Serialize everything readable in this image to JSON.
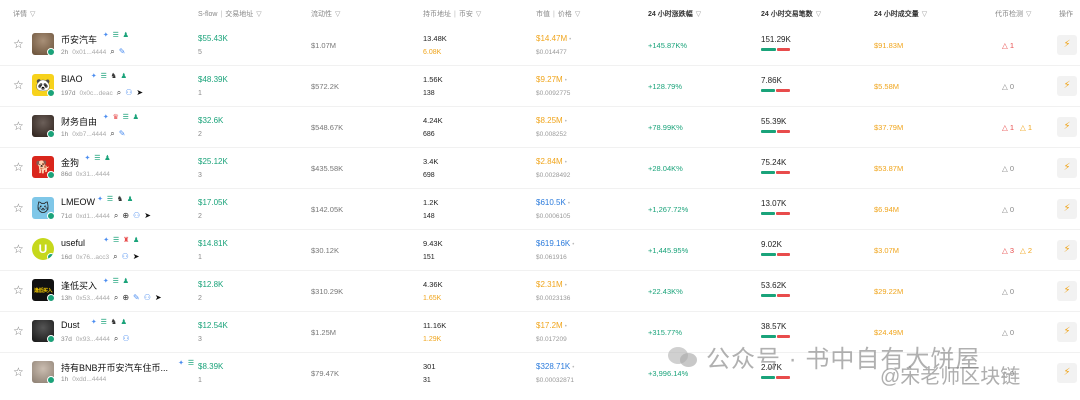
{
  "header": {
    "details": "详情",
    "sflow": "S-flow",
    "tx_addr": "交易地址",
    "liquidity": "流动性",
    "holders": "持币地址",
    "age": "币安",
    "mcap": "市值",
    "price": "价格",
    "change24": "24 小时涨跌幅",
    "tx24": "24 小时交易笔数",
    "vol24": "24 小时成交量",
    "detect": "代币检测",
    "ops": "操作",
    "filter_icon": "funnel-icon"
  },
  "rows": [
    {
      "name": "币安汽车",
      "age": "2h",
      "addr": "0x01...4444",
      "sflow": "$55.43K",
      "sflow_count": "5",
      "liquidity": "$1.07M",
      "holders": "13.48K",
      "holders2": "6.08K",
      "holders2_orange": true,
      "mcap": "$14.47M",
      "mcap_blue": false,
      "price": "$0.014477",
      "change": "+145.87K%",
      "tx": "151.29K",
      "green_ratio": 0.55,
      "vol": "$91.83M",
      "detect": [
        {
          "icon": "△",
          "val": "1",
          "kind": "red"
        }
      ],
      "avatar": {
        "type": "image",
        "bg": "#8b6a4a",
        "glyph": ""
      },
      "tags": [
        "spark",
        "bars",
        "people"
      ],
      "subicons": [
        "search",
        "pen"
      ]
    },
    {
      "name": "BIAO",
      "age": "197d",
      "addr": "0x0c...deac",
      "sflow": "$48.39K",
      "sflow_count": "1",
      "liquidity": "$572.2K",
      "holders": "1.56K",
      "holders2": "138",
      "holders2_orange": false,
      "mcap": "$9.27M",
      "mcap_blue": false,
      "price": "$0.0092775",
      "change": "+128.79%",
      "tx": "7.86K",
      "green_ratio": 0.5,
      "vol": "$5.58M",
      "detect": [
        {
          "icon": "△",
          "val": "0",
          "kind": "grey"
        }
      ],
      "avatar": {
        "type": "panda",
        "bg": "#f7d21c",
        "glyph": "🐼"
      },
      "tags": [
        "spark",
        "bars",
        "fox",
        "people"
      ],
      "subicons": [
        "search",
        "user",
        "tg"
      ]
    },
    {
      "name": "财务自由",
      "age": "1h",
      "addr": "0xb7...4444",
      "sflow": "$32.6K",
      "sflow_count": "2",
      "liquidity": "$548.67K",
      "holders": "4.24K",
      "holders2": "686",
      "holders2_orange": false,
      "mcap": "$8.25M",
      "mcap_blue": false,
      "price": "$0.008252",
      "change": "+78.99K%",
      "tx": "55.39K",
      "green_ratio": 0.55,
      "vol": "$37.79M",
      "detect": [
        {
          "icon": "△",
          "val": "1",
          "kind": "red"
        },
        {
          "icon": "△",
          "val": "1",
          "kind": "amber"
        }
      ],
      "avatar": {
        "type": "image",
        "bg": "#3a2a22",
        "glyph": ""
      },
      "tags": [
        "spark",
        "dup",
        "bars",
        "people"
      ],
      "subicons": [
        "search",
        "pen"
      ]
    },
    {
      "name": "金狗",
      "age": "86d",
      "addr": "0x31...4444",
      "sflow": "$25.12K",
      "sflow_count": "3",
      "liquidity": "$435.58K",
      "holders": "3.4K",
      "holders2": "698",
      "holders2_orange": false,
      "mcap": "$2.84M",
      "mcap_blue": false,
      "price": "$0.0028492",
      "change": "+28.04K%",
      "tx": "75.24K",
      "green_ratio": 0.5,
      "vol": "$53.87M",
      "detect": [
        {
          "icon": "△",
          "val": "0",
          "kind": "grey"
        }
      ],
      "avatar": {
        "type": "dog",
        "bg": "#d9261c",
        "glyph": "🐕"
      },
      "tags": [
        "spark",
        "bars",
        "people"
      ],
      "subicons": []
    },
    {
      "name": "LMEOW",
      "age": "71d",
      "addr": "0xd1...4444",
      "sflow": "$17.05K",
      "sflow_count": "2",
      "liquidity": "$142.05K",
      "holders": "1.2K",
      "holders2": "148",
      "holders2_orange": false,
      "mcap": "$610.5K",
      "mcap_blue": true,
      "price": "$0.0006105",
      "change": "+1,267.72%",
      "tx": "13.07K",
      "green_ratio": 0.5,
      "vol": "$6.94M",
      "detect": [
        {
          "icon": "△",
          "val": "0",
          "kind": "grey"
        }
      ],
      "avatar": {
        "type": "cat",
        "bg": "#7fc7e8",
        "glyph": "🐱"
      },
      "tags": [
        "spark",
        "bars",
        "fox",
        "people"
      ],
      "subicons": [
        "search",
        "globe",
        "user",
        "tg"
      ]
    },
    {
      "name": "useful",
      "age": "16d",
      "addr": "0x76...acc3",
      "sflow": "$14.81K",
      "sflow_count": "1",
      "liquidity": "$30.12K",
      "holders": "9.43K",
      "holders2": "151",
      "holders2_orange": false,
      "mcap": "$619.16K",
      "mcap_blue": true,
      "price": "$0.061916",
      "change": "+1,445.95%",
      "tx": "9.02K",
      "green_ratio": 0.55,
      "vol": "$3.07M",
      "detect": [
        {
          "icon": "△",
          "val": "3",
          "kind": "red"
        },
        {
          "icon": "△",
          "val": "2",
          "kind": "amber"
        }
      ],
      "avatar": {
        "type": "letter",
        "bg": "#c6d81c",
        "glyph": "U"
      },
      "tags": [
        "spark",
        "bars",
        "alert",
        "people"
      ],
      "subicons": [
        "search",
        "user",
        "tg"
      ]
    },
    {
      "name": "逢低买入",
      "age": "13h",
      "addr": "0x53...4444",
      "sflow": "$12.8K",
      "sflow_count": "2",
      "liquidity": "$310.29K",
      "holders": "4.36K",
      "holders2": "1.65K",
      "holders2_orange": true,
      "mcap": "$2.31M",
      "mcap_blue": false,
      "price": "$0.0023136",
      "change": "+22.43K%",
      "tx": "53.62K",
      "green_ratio": 0.55,
      "vol": "$29.22M",
      "detect": [
        {
          "icon": "△",
          "val": "0",
          "kind": "grey"
        }
      ],
      "avatar": {
        "type": "text",
        "bg": "#111111",
        "glyph": "逢低买入"
      },
      "tags": [
        "spark",
        "bars",
        "people"
      ],
      "subicons": [
        "search",
        "globe",
        "pen",
        "user",
        "tg"
      ]
    },
    {
      "name": "Dust",
      "age": "37d",
      "addr": "0x93...4444",
      "sflow": "$12.54K",
      "sflow_count": "3",
      "liquidity": "$1.25M",
      "holders": "11.16K",
      "holders2": "1.29K",
      "holders2_orange": true,
      "mcap": "$17.2M",
      "mcap_blue": false,
      "price": "$0.017209",
      "change": "+315.77%",
      "tx": "38.57K",
      "green_ratio": 0.55,
      "vol": "$24.49M",
      "detect": [
        {
          "icon": "△",
          "val": "0",
          "kind": "grey"
        }
      ],
      "avatar": {
        "type": "image",
        "bg": "#1c1c1c",
        "glyph": ""
      },
      "tags": [
        "spark",
        "bars",
        "fox",
        "people"
      ],
      "subicons": [
        "search",
        "user"
      ]
    },
    {
      "name": "持有BNB开币安汽车住币...",
      "age": "1h",
      "addr": "0xdd...4444",
      "sflow": "$8.39K",
      "sflow_count": "1",
      "liquidity": "$79.47K",
      "holders": "301",
      "holders2": "31",
      "holders2_orange": false,
      "mcap": "$328.71K",
      "mcap_blue": true,
      "price": "$0.00032871",
      "change": "+3,996.14%",
      "tx": "2.07K",
      "green_ratio": 0.5,
      "vol": "",
      "detect": [
        {
          "icon": "△",
          "val": "0",
          "kind": "grey"
        }
      ],
      "avatar": {
        "type": "image",
        "bg": "#b9a796",
        "glyph": ""
      },
      "tags": [
        "spark",
        "bars"
      ],
      "subicons": []
    }
  ],
  "watermark": {
    "main": "公众号 · 书中自有大饼屋",
    "sub": "@宋老师区块链"
  },
  "colors": {
    "green": "#1aa37a",
    "red": "#e84c4c",
    "orange": "#f0a51c",
    "blue": "#2b7bdc"
  }
}
